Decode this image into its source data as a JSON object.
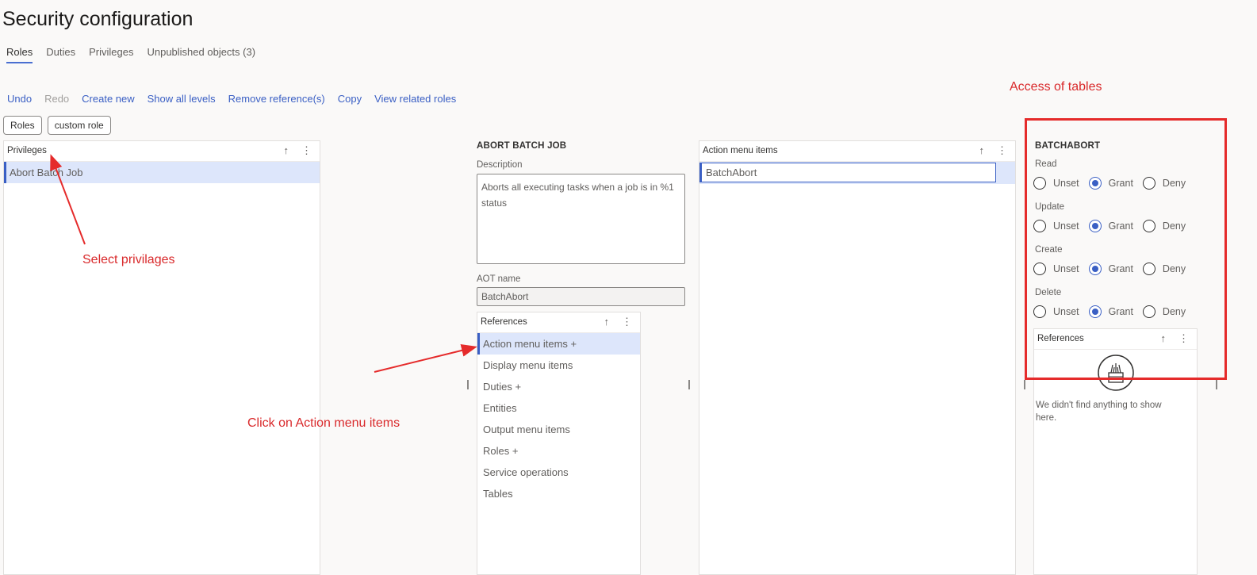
{
  "header": {
    "title": "Security configuration"
  },
  "tabs": [
    {
      "label": "Roles",
      "active": true
    },
    {
      "label": "Duties"
    },
    {
      "label": "Privileges"
    },
    {
      "label": "Unpublished objects (3)"
    }
  ],
  "actions": [
    {
      "label": "Undo"
    },
    {
      "label": "Redo",
      "disabled": true
    },
    {
      "label": "Create new"
    },
    {
      "label": "Show all levels"
    },
    {
      "label": "Remove reference(s)"
    },
    {
      "label": "Copy"
    },
    {
      "label": "View related roles"
    }
  ],
  "breadcrumbs": [
    "Roles",
    "custom role"
  ],
  "privileges_panel": {
    "header": "Privileges",
    "items": [
      "Abort Batch Job"
    ]
  },
  "details": {
    "title": "ABORT BATCH JOB",
    "description_label": "Description",
    "description": "Aborts all executing tasks when a job is in %1 status",
    "aot_label": "AOT name",
    "aot_value": "BatchAbort",
    "references_header": "References",
    "references": [
      "Action menu items +",
      "Display menu items",
      "Duties +",
      "Entities",
      "Output menu items",
      "Roles +",
      "Service operations",
      "Tables"
    ]
  },
  "action_items_panel": {
    "header": "Action menu items",
    "items": [
      "BatchAbort"
    ]
  },
  "access_panel": {
    "title": "BATCHABORT",
    "groups": [
      {
        "label": "Read",
        "selected": "Grant"
      },
      {
        "label": "Update",
        "selected": "Grant"
      },
      {
        "label": "Create",
        "selected": "Grant"
      },
      {
        "label": "Delete",
        "selected": "Grant"
      }
    ],
    "options": [
      "Unset",
      "Grant",
      "Deny"
    ],
    "references_header": "References",
    "empty_text": "We didn't find anything to show here."
  },
  "annotations": {
    "select_privileges": "Select privilages",
    "click_action_menu": "Click on Action menu items",
    "access_tables": "Access of tables"
  },
  "colors": {
    "accent": "#3a5fc4",
    "selection": "#dde6fb",
    "annotation": "#d9292b"
  }
}
